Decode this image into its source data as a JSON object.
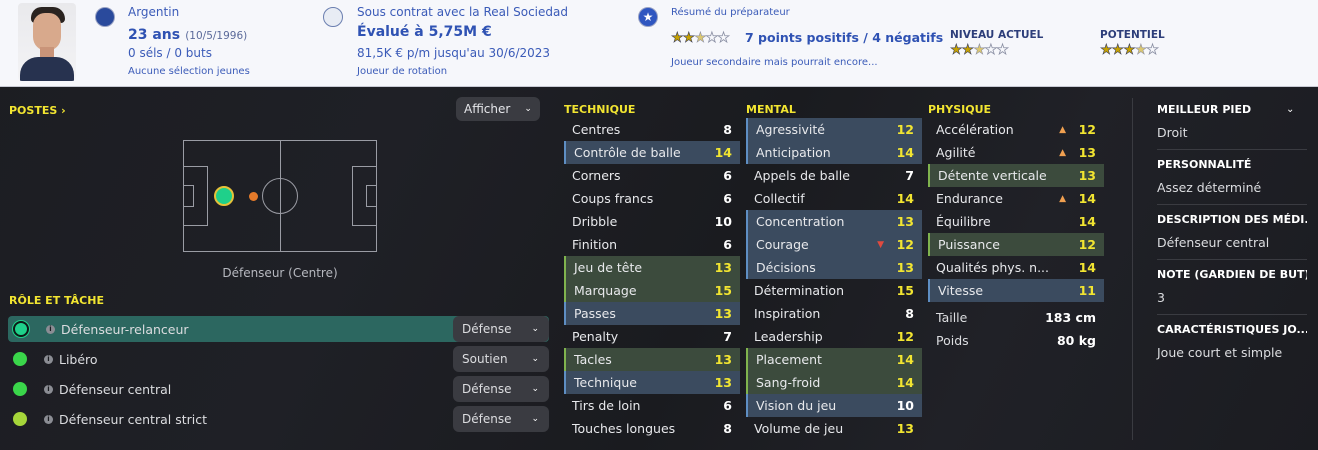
{
  "header": {
    "nationality": "Argentin",
    "age": "23 ans",
    "birthdate": "(10/5/1996)",
    "caps": "0 séls / 0 buts",
    "youth_caps": "Aucune sélection jeunes",
    "contract": "Sous contrat avec la Real Sociedad",
    "value": "Évalué à 5,75M €",
    "wage": "81,5K € p/m jusqu'au 30/6/2023",
    "squad_status": "Joueur de rotation",
    "scout_title": "Résumé du préparateur",
    "scout_summary": "7 points positifs / 4 négatifs",
    "scout_note": "Joueur secondaire mais pourrait encore...",
    "current_label": "NIVEAU ACTUEL",
    "potential_label": "POTENTIEL",
    "scout_stars": 2.5,
    "current_stars": 2.5,
    "potential_stars": 3.5
  },
  "positions": {
    "title": "POSTES",
    "show_button": "Afficher",
    "caption": "Défenseur (Centre)"
  },
  "roles": {
    "title": "RÔLE ET TÂCHE",
    "items": [
      {
        "name": "Défenseur-relanceur",
        "duty": "Défense",
        "color": "#1fd08a"
      },
      {
        "name": "Libéro",
        "duty": "Soutien",
        "color": "#3ad64a"
      },
      {
        "name": "Défenseur central",
        "duty": "Défense",
        "color": "#3ad64a"
      },
      {
        "name": "Défenseur central strict",
        "duty": "Défense",
        "color": "#a6d63a"
      }
    ]
  },
  "technical": {
    "title": "TECHNIQUE",
    "attrs": [
      {
        "name": "Centres",
        "value": 8,
        "hl": ""
      },
      {
        "name": "Contrôle de balle",
        "value": 14,
        "hl": "blue"
      },
      {
        "name": "Corners",
        "value": 6,
        "hl": ""
      },
      {
        "name": "Coups francs",
        "value": 6,
        "hl": ""
      },
      {
        "name": "Dribble",
        "value": 10,
        "hl": ""
      },
      {
        "name": "Finition",
        "value": 6,
        "hl": ""
      },
      {
        "name": "Jeu de tête",
        "value": 13,
        "hl": "green"
      },
      {
        "name": "Marquage",
        "value": 15,
        "hl": "green"
      },
      {
        "name": "Passes",
        "value": 13,
        "hl": "blue"
      },
      {
        "name": "Penalty",
        "value": 7,
        "hl": ""
      },
      {
        "name": "Tacles",
        "value": 13,
        "hl": "green"
      },
      {
        "name": "Technique",
        "value": 13,
        "hl": "blue"
      },
      {
        "name": "Tirs de loin",
        "value": 6,
        "hl": ""
      },
      {
        "name": "Touches longues",
        "value": 8,
        "hl": ""
      }
    ]
  },
  "mental": {
    "title": "MENTAL",
    "attrs": [
      {
        "name": "Agressivité",
        "value": 12,
        "hl": "blue"
      },
      {
        "name": "Anticipation",
        "value": 14,
        "hl": "blue"
      },
      {
        "name": "Appels de balle",
        "value": 7,
        "hl": ""
      },
      {
        "name": "Collectif",
        "value": 14,
        "hl": ""
      },
      {
        "name": "Concentration",
        "value": 13,
        "hl": "blue"
      },
      {
        "name": "Courage",
        "value": 12,
        "hl": "blue",
        "trend": "down"
      },
      {
        "name": "Décisions",
        "value": 13,
        "hl": "blue"
      },
      {
        "name": "Détermination",
        "value": 15,
        "hl": ""
      },
      {
        "name": "Inspiration",
        "value": 8,
        "hl": ""
      },
      {
        "name": "Leadership",
        "value": 12,
        "hl": ""
      },
      {
        "name": "Placement",
        "value": 14,
        "hl": "green"
      },
      {
        "name": "Sang-froid",
        "value": 14,
        "hl": "green"
      },
      {
        "name": "Vision du jeu",
        "value": 10,
        "hl": "blue"
      },
      {
        "name": "Volume de jeu",
        "value": 13,
        "hl": ""
      }
    ]
  },
  "physical": {
    "title": "PHYSIQUE",
    "attrs": [
      {
        "name": "Accélération",
        "value": 12,
        "hl": "",
        "trend": "up"
      },
      {
        "name": "Agilité",
        "value": 13,
        "hl": "",
        "trend": "up"
      },
      {
        "name": "Détente verticale",
        "value": 13,
        "hl": "green"
      },
      {
        "name": "Endurance",
        "value": 14,
        "hl": "",
        "trend": "up"
      },
      {
        "name": "Équilibre",
        "value": 14,
        "hl": ""
      },
      {
        "name": "Puissance",
        "value": 12,
        "hl": "green"
      },
      {
        "name": "Qualités phys. n...",
        "value": 14,
        "hl": ""
      },
      {
        "name": "Vitesse",
        "value": 11,
        "hl": "blue"
      }
    ],
    "height_label": "Taille",
    "height": "183 cm",
    "weight_label": "Poids",
    "weight": "80 kg"
  },
  "info": [
    {
      "key": "MEILLEUR PIED",
      "value": "Droit"
    },
    {
      "key": "PERSONNALITÉ",
      "value": "Assez déterminé"
    },
    {
      "key": "DESCRIPTION DES MÉDI...",
      "value": "Défenseur central"
    },
    {
      "key": "NOTE (GARDIEN DE BUT)",
      "value": "3"
    },
    {
      "key": "CARACTÉRISTIQUES JO...",
      "value": "Joue court et simple"
    }
  ]
}
